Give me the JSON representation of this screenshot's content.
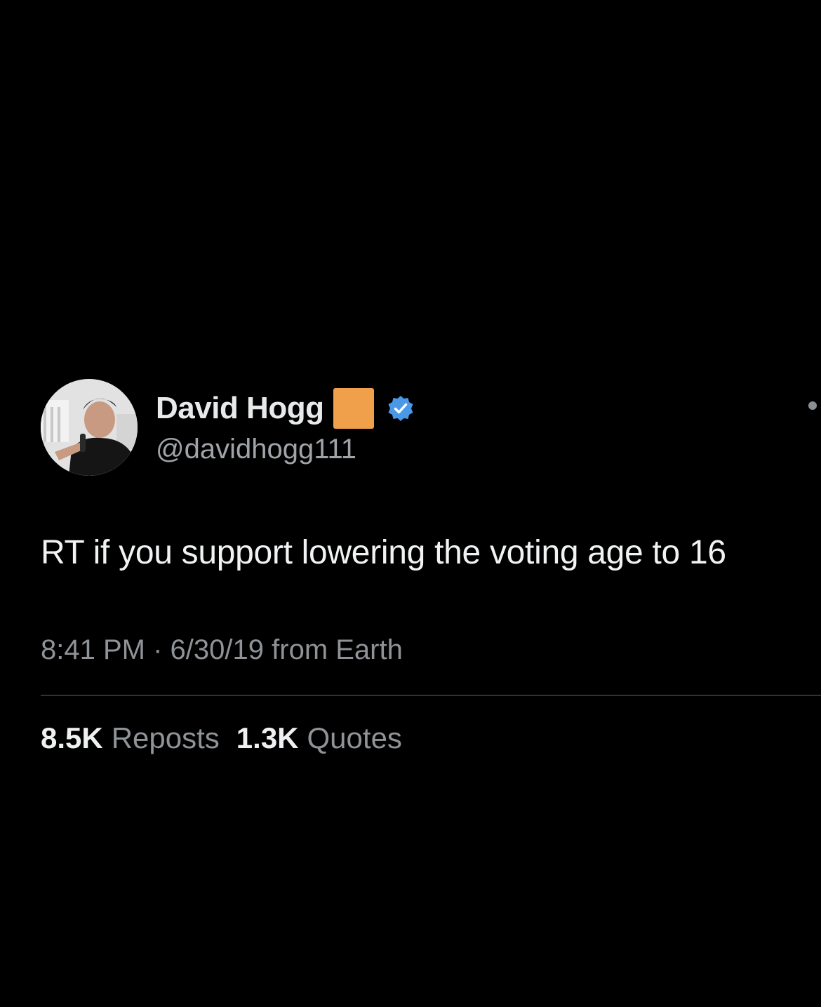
{
  "tweet": {
    "display_name": "David Hogg",
    "handle": "@davidhogg111",
    "emoji_square_color": "#f0a04b",
    "verified_badge_color": "#4a99e9",
    "avatar_icon": "profile-photo",
    "text": "RT if you support lowering the voting age to 16",
    "time": "8:41 PM",
    "separator": "·",
    "date": "6/30/19",
    "source": "from Earth"
  },
  "stats": [
    {
      "count": "8.5K",
      "label": "Reposts"
    },
    {
      "count": "1.3K",
      "label": "Quotes"
    }
  ],
  "colors": {
    "background": "#000000",
    "primary_text": "#e7e9ea",
    "secondary_text": "#8f9397",
    "divider": "#2f3336"
  }
}
